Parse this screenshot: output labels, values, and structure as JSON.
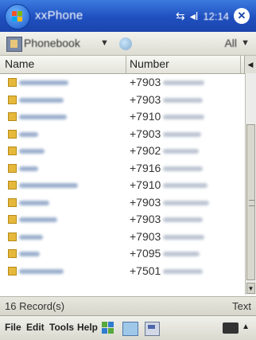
{
  "titlebar": {
    "app_title": "xxPhone",
    "clock": "12:14",
    "close_label": "✕",
    "signal_icon": "signal-icon",
    "volume_icon": "volume-icon"
  },
  "toolbar": {
    "phonebook_label": "Phonebook",
    "filter_label": "All",
    "dropdown_glyph": "▼"
  },
  "table": {
    "columns": [
      "Name",
      "Number"
    ],
    "rows": [
      {
        "prefix": "+7903",
        "name_w": 62,
        "num_w": 52
      },
      {
        "prefix": "+7903",
        "name_w": 56,
        "num_w": 50
      },
      {
        "prefix": "+7910",
        "name_w": 60,
        "num_w": 52
      },
      {
        "prefix": "+7903",
        "name_w": 24,
        "num_w": 48
      },
      {
        "prefix": "+7902",
        "name_w": 32,
        "num_w": 45
      },
      {
        "prefix": "+7916",
        "name_w": 24,
        "num_w": 50
      },
      {
        "prefix": "+7910",
        "name_w": 74,
        "num_w": 56
      },
      {
        "prefix": "+7903",
        "name_w": 38,
        "num_w": 58
      },
      {
        "prefix": "+7903",
        "name_w": 48,
        "num_w": 50
      },
      {
        "prefix": "+7903",
        "name_w": 30,
        "num_w": 52
      },
      {
        "prefix": "+7095",
        "name_w": 26,
        "num_w": 46
      },
      {
        "prefix": "+7501",
        "name_w": 56,
        "num_w": 50
      }
    ]
  },
  "statusbar": {
    "records": "16 Record(s)",
    "text": "Text"
  },
  "menubar": {
    "file": "File",
    "edit": "Edit",
    "tools": "Tools",
    "help": "Help"
  }
}
